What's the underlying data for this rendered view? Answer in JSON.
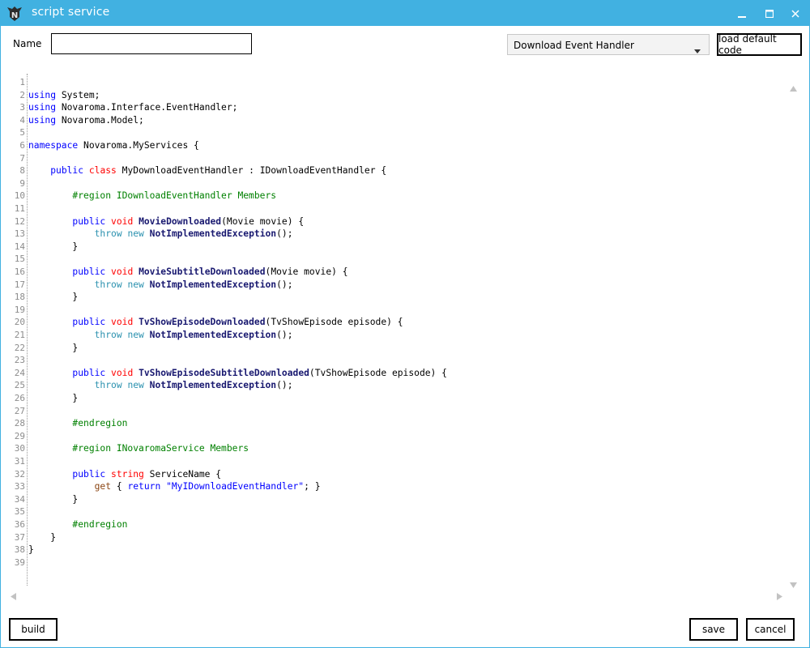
{
  "window": {
    "title": "script service",
    "app_icon": "n-logo-icon",
    "controls": [
      "minimize-icon",
      "maximize-icon",
      "close-icon"
    ]
  },
  "form": {
    "name_label": "Name",
    "name_value": "",
    "handler_select_value": "Download Event Handler",
    "load_default_label": "load default code"
  },
  "editor": {
    "lines": [
      "",
      "using System;",
      "using Novaroma.Interface.EventHandler;",
      "using Novaroma.Model;",
      "",
      "namespace Novaroma.MyServices {",
      "",
      "    public class MyDownloadEventHandler : IDownloadEventHandler {",
      "",
      "        #region IDownloadEventHandler Members",
      "",
      "        public void MovieDownloaded(Movie movie) {",
      "            throw new NotImplementedException();",
      "        }",
      "",
      "        public void MovieSubtitleDownloaded(Movie movie) {",
      "            throw new NotImplementedException();",
      "        }",
      "",
      "        public void TvShowEpisodeDownloaded(TvShowEpisode episode) {",
      "            throw new NotImplementedException();",
      "        }",
      "",
      "        public void TvShowEpisodeSubtitleDownloaded(TvShowEpisode episode) {",
      "            throw new NotImplementedException();",
      "        }",
      "",
      "        #endregion",
      "",
      "        #region INovaromaService Members",
      "",
      "        public string ServiceName {",
      "            get { return \"MyIDownloadEventHandler\"; }",
      "        }",
      "",
      "        #endregion",
      "    }",
      "}",
      ""
    ]
  },
  "footer": {
    "build_label": "build",
    "save_label": "save",
    "cancel_label": "cancel"
  },
  "colors": {
    "titlebar": "#41b1e1",
    "keyword": "#0000ff",
    "type_keyword": "#2b91af",
    "class_keyword": "#ff0000",
    "method": "#191970",
    "region": "#008000",
    "line_number": "#8c8c8c"
  }
}
